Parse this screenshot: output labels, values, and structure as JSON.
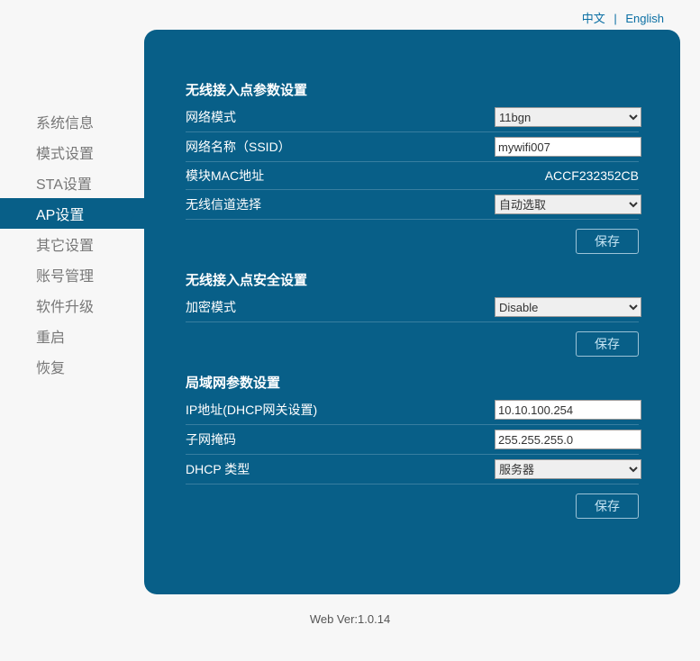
{
  "lang": {
    "cn": "中文",
    "en": "English"
  },
  "sidebar": {
    "items": [
      {
        "label": "系统信息"
      },
      {
        "label": "模式设置"
      },
      {
        "label": "STA设置"
      },
      {
        "label": "AP设置"
      },
      {
        "label": "其它设置"
      },
      {
        "label": "账号管理"
      },
      {
        "label": "软件升级"
      },
      {
        "label": "重启"
      },
      {
        "label": "恢复"
      }
    ]
  },
  "sec1": {
    "title": "无线接入点参数设置",
    "mode_label": "网络模式",
    "mode_value": "11bgn",
    "ssid_label": "网络名称（SSID）",
    "ssid_value": "mywifi007",
    "mac_label": "模块MAC地址",
    "mac_value": "ACCF232352CB",
    "channel_label": "无线信道选择",
    "channel_value": "自动选取",
    "save": "保存"
  },
  "sec2": {
    "title": "无线接入点安全设置",
    "enc_label": "加密模式",
    "enc_value": "Disable",
    "save": "保存"
  },
  "sec3": {
    "title": "局域网参数设置",
    "ip_label": "IP地址(DHCP网关设置)",
    "ip_value": "10.10.100.254",
    "mask_label": "子网掩码",
    "mask_value": "255.255.255.0",
    "dhcp_label": "DHCP 类型",
    "dhcp_value": "服务器",
    "save": "保存"
  },
  "footer": "Web Ver:1.0.14"
}
